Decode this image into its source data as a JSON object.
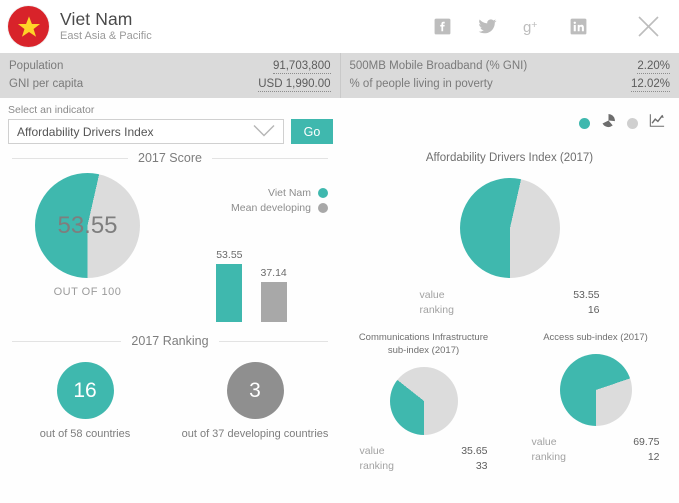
{
  "colors": {
    "teal": "#3fb8ae",
    "gray_dark": "#a8a8a8",
    "gray_light": "#dcdcdc",
    "flag_red": "#d8232a",
    "flag_star": "#ffd428"
  },
  "header": {
    "country": "Viet Nam",
    "region": "East Asia & Pacific",
    "flag_icon": "vietnam-flag-icon",
    "social": [
      {
        "name": "facebook-icon",
        "label": "Facebook"
      },
      {
        "name": "twitter-icon",
        "label": "Twitter"
      },
      {
        "name": "googleplus-icon",
        "label": "Google Plus"
      },
      {
        "name": "linkedin-icon",
        "label": "LinkedIn"
      }
    ],
    "close_icon": "close-icon"
  },
  "stats": {
    "left": [
      {
        "label": "Population",
        "value": "91,703,800"
      },
      {
        "label": "GNI per capita",
        "value": "USD 1,990.00"
      }
    ],
    "right": [
      {
        "label": "500MB Mobile Broadband (% GNI)",
        "value": "2.20%"
      },
      {
        "label": "% of people living in poverty",
        "value": "12.02%"
      }
    ]
  },
  "selector": {
    "label": "Select an indicator",
    "selected": "Affordability Drivers Index",
    "chevron_icon": "chevron-down-icon",
    "go_label": "Go"
  },
  "view_toggles": [
    {
      "name": "view-dot-active",
      "type": "dot",
      "state": "on"
    },
    {
      "name": "pie-chart-icon",
      "type": "icon",
      "state": "on"
    },
    {
      "name": "view-dot-inactive",
      "type": "dot",
      "state": "off"
    },
    {
      "name": "line-chart-icon",
      "type": "icon",
      "state": "off"
    }
  ],
  "left_panel": {
    "score_section_title": "2017 Score",
    "out_of_label": "OUT OF 100",
    "ranking_section_title": "2017 Ranking",
    "legend": [
      {
        "label": "Viet Nam",
        "color": "#3fb8ae"
      },
      {
        "label": "Mean developing",
        "color": "#a8a8a8"
      }
    ],
    "rankings": [
      {
        "value": "16",
        "caption": "out of 58 countries",
        "color": "#3fb8ae"
      },
      {
        "value": "3",
        "caption": "out of 37 developing countries",
        "color": "#8f8f8f"
      }
    ]
  },
  "vr_labels": {
    "value": "value",
    "ranking": "ranking"
  },
  "chart_data": [
    {
      "type": "pie",
      "name": "score-donut",
      "title": "2017 Score",
      "center_label": "53.55",
      "sublabel": "OUT OF 100",
      "categories": [
        "Viet Nam",
        "Remaining"
      ],
      "values": [
        53.55,
        46.45
      ],
      "colors": [
        "#3fb8ae",
        "#dcdcdc"
      ],
      "legend_position": "right"
    },
    {
      "type": "bar",
      "name": "score-comparison-bars",
      "categories": [
        "Viet Nam",
        "Mean developing"
      ],
      "values": [
        53.55,
        37.14
      ],
      "colors": [
        "#3fb8ae",
        "#a8a8a8"
      ],
      "ylim": [
        0,
        60
      ],
      "grid": false,
      "xlabel": "",
      "ylabel": ""
    },
    {
      "type": "pie",
      "name": "affordability-drivers-index-pie",
      "title": "Affordability Drivers Index (2017)",
      "categories": [
        "value",
        "remaining"
      ],
      "values": [
        53.55,
        46.45
      ],
      "colors": [
        "#3fb8ae",
        "#dcdcdc"
      ],
      "annotations": {
        "value": "53.55",
        "ranking": "16"
      }
    },
    {
      "type": "pie",
      "name": "communications-infrastructure-subindex-pie",
      "title": "Communications Infrastructure sub-index (2017)",
      "categories": [
        "value",
        "remaining"
      ],
      "values": [
        35.65,
        64.35
      ],
      "colors": [
        "#3fb8ae",
        "#dcdcdc"
      ],
      "annotations": {
        "value": "35.65",
        "ranking": "33"
      }
    },
    {
      "type": "pie",
      "name": "access-subindex-pie",
      "title": "Access sub-index (2017)",
      "categories": [
        "value",
        "remaining"
      ],
      "values": [
        69.75,
        30.25
      ],
      "colors": [
        "#3fb8ae",
        "#dcdcdc"
      ],
      "annotations": {
        "value": "69.75",
        "ranking": "12"
      }
    }
  ]
}
